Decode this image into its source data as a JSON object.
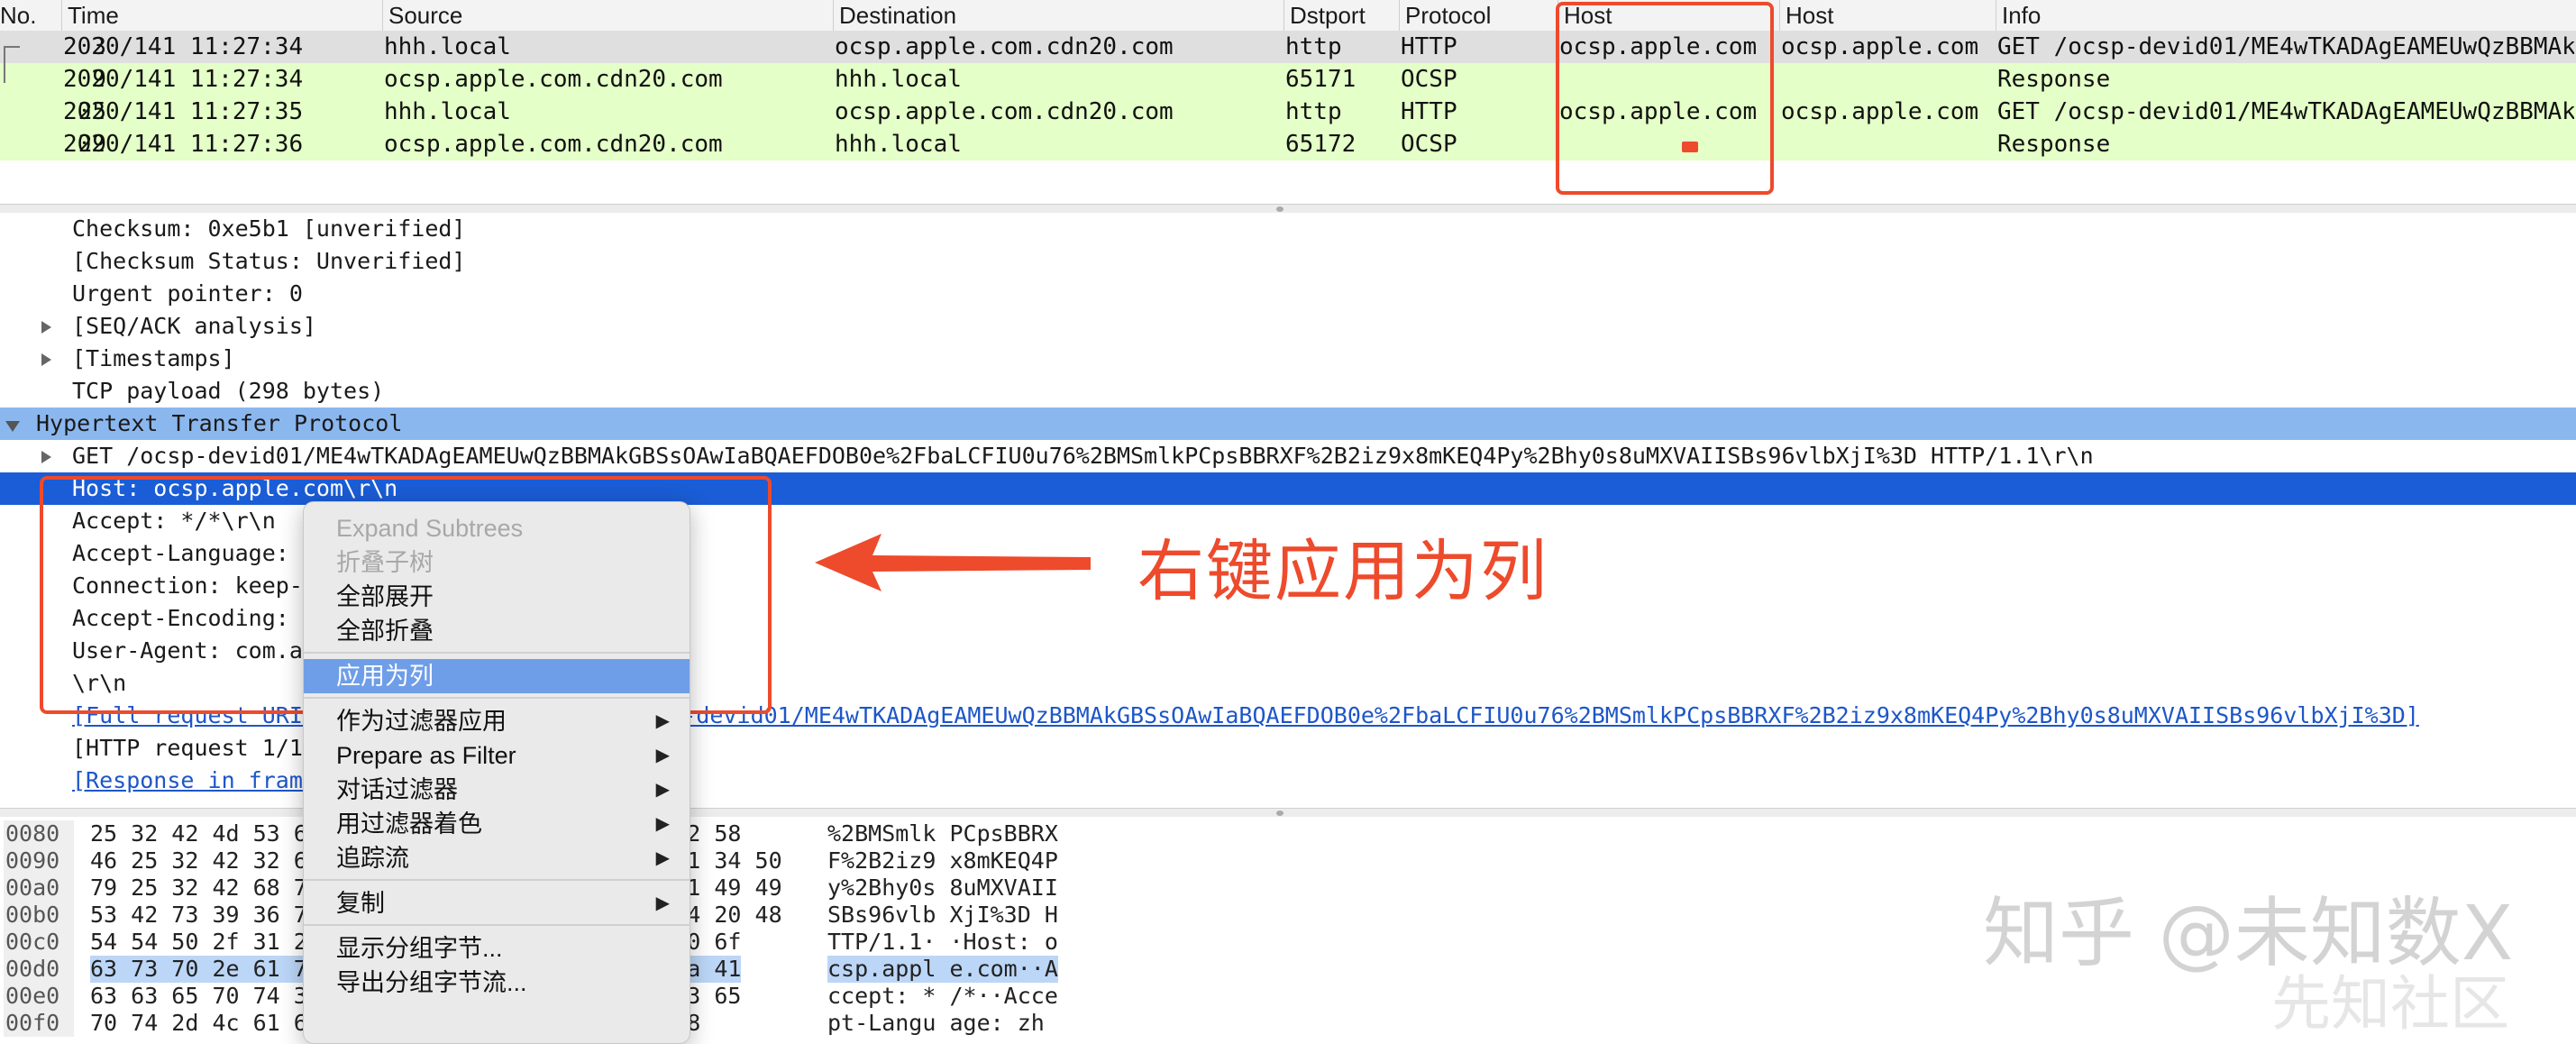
{
  "packet_list": {
    "columns": [
      "No.",
      "Time",
      "Source",
      "Destination",
      "Dstport",
      "Protocol",
      "Host",
      "Host",
      "Info"
    ],
    "rows": [
      {
        "no": "3",
        "time": "2020/141 11:27:34",
        "source": "hhh.local",
        "destination": "ocsp.apple.com.cdn20.com",
        "dstport": "http",
        "protocol": "HTTP",
        "host1": "ocsp.apple.com",
        "host2": "ocsp.apple.com",
        "info": "GET /ocsp-devid01/ME4wTKADAgEAMEUwQzBBMAkGBSsOAwIaBQAEFDOB0e%2FbaLCFIU0u76%2BMSmlkPCpsBBRXF%2B2iz9x8mKEQ4Py%2Bhy0s8uMXVAIISBs96vlbXjI%3D HTTP/1.1"
      },
      {
        "no": "9",
        "time": "2020/141 11:27:34",
        "source": "ocsp.apple.com.cdn20.com",
        "destination": "hhh.local",
        "dstport": "65171",
        "protocol": "OCSP",
        "host1": "",
        "host2": "",
        "info": "Response"
      },
      {
        "no": "25",
        "time": "2020/141 11:27:35",
        "source": "hhh.local",
        "destination": "ocsp.apple.com.cdn20.com",
        "dstport": "http",
        "protocol": "HTTP",
        "host1": "ocsp.apple.com",
        "host2": "ocsp.apple.com",
        "info": "GET /ocsp-devid01/ME4wTKADAgEAMEUwQzBBMAkGBSsOAwIaBQAEFDOB0e%2FbaLCFIU0u76%2BMSmlkPCpsBBRXF%2B2iz9x8mKEQ4Py%2Bhy0s8uMXVAIISBs96vlbXjI%3D HTTP/1.1"
      },
      {
        "no": "29",
        "time": "2020/141 11:27:36",
        "source": "ocsp.apple.com.cdn20.com",
        "destination": "hhh.local",
        "dstport": "65172",
        "protocol": "OCSP",
        "host1": "",
        "host2": "",
        "info": "Response"
      }
    ]
  },
  "details": {
    "rows": [
      {
        "text": "Checksum: 0xe5b1 [unverified]",
        "indent": 1,
        "toggle": "none",
        "style": "normal"
      },
      {
        "text": "[Checksum Status: Unverified]",
        "indent": 1,
        "toggle": "none",
        "style": "normal"
      },
      {
        "text": "Urgent pointer: 0",
        "indent": 1,
        "toggle": "none",
        "style": "normal"
      },
      {
        "text": "[SEQ/ACK analysis]",
        "indent": 1,
        "toggle": "right",
        "style": "normal"
      },
      {
        "text": "[Timestamps]",
        "indent": 1,
        "toggle": "right",
        "style": "normal"
      },
      {
        "text": "TCP payload (298 bytes)",
        "indent": 1,
        "toggle": "none",
        "style": "normal"
      },
      {
        "text": "Hypertext Transfer Protocol",
        "indent": 0,
        "toggle": "down",
        "style": "highlight"
      },
      {
        "text": "GET /ocsp-devid01/ME4wTKADAgEAMEUwQzBBMAkGBSsOAwIaBQAEFDOB0e%2FbaLCFIU0u76%2BMSmlkPCpsBBRXF%2B2iz9x8mKEQ4Py%2Bhy0s8uMXVAIISBs96vlbXjI%3D HTTP/1.1\\r\\n",
        "indent": 1,
        "toggle": "right",
        "style": "normal"
      },
      {
        "text": "Host: ocsp.apple.com\\r\\n",
        "indent": 1,
        "toggle": "none",
        "style": "selected"
      },
      {
        "text": "Accept: */*\\r\\n",
        "indent": 1,
        "toggle": "none",
        "style": "normal"
      },
      {
        "text": "Accept-Language: ",
        "indent": 1,
        "toggle": "none",
        "style": "normal"
      },
      {
        "text": "Connection: keep-",
        "indent": 1,
        "toggle": "none",
        "style": "normal"
      },
      {
        "text": "Accept-Encoding: ",
        "indent": 1,
        "toggle": "none",
        "style": "normal"
      },
      {
        "text": "User-Agent: com.a",
        "indent": 1,
        "toggle": "none",
        "style": "normal"
      },
      {
        "text": "\\r\\n",
        "indent": 1,
        "toggle": "none",
        "style": "normal"
      },
      {
        "text": "[Full request URI: http://ocsp.apple.com/ocsp-devid01/ME4wTKADAgEAMEUwQzBBMAkGBSsOAwIaBQAEFDOB0e%2FbaLCFIU0u76%2BMSmlkPCpsBBRXF%2B2iz9x8mKEQ4Py%2Bhy0s8uMXVAIISBs96vlbXjI%3D]",
        "indent": 1,
        "toggle": "none",
        "style": "link"
      },
      {
        "text": "[HTTP request 1/1]",
        "indent": 1,
        "toggle": "none",
        "style": "normal"
      },
      {
        "text": "[Response in frame: 29]",
        "indent": 1,
        "toggle": "none",
        "style": "link"
      }
    ]
  },
  "bytes": {
    "rows": [
      {
        "offset": "0080",
        "hex": "25 32 42 4d 53 6d 6c 6b  20 50 43 70 73 42 52 58",
        "ascii": "%2BMSmlk PCpsBBRX",
        "highlight": false
      },
      {
        "offset": "0090",
        "hex": "46 25 32 42 32 69 7a 39  20 78 38 6d 4b 45 51 34 50",
        "ascii": "F%2B2iz9 x8mKEQ4P",
        "highlight": false
      },
      {
        "offset": "00a0",
        "hex": "79 25 32 42 68 79 30 73  20 38 75 4d 58 56 41 49 49",
        "ascii": "y%2Bhy0s 8uMXVAII",
        "highlight": false
      },
      {
        "offset": "00b0",
        "hex": "53 42 73 39 36 76 6c 62  20 58 6a 49 25 33 44 20 48",
        "ascii": "SBs96vlb XjI%3D H",
        "highlight": false
      },
      {
        "offset": "00c0",
        "hex": "54 54 50 2f 31 2e 31 0d  0a 48 6f 73 74 3a 20 6f",
        "ascii": "TTP/1.1· ·Host: o",
        "highlight": false
      },
      {
        "offset": "00d0",
        "hex": "63 73 70 2e 61 70 70 6c  65 2e 63 6f 6d 0d 0a 41",
        "ascii": "csp.appl e.com··A",
        "highlight": true
      },
      {
        "offset": "00e0",
        "hex": "63 63 65 70 74 3a 20 2a  2f 2a 0d 0a 41 63 63 65",
        "ascii": "ccept: * /*··Acce",
        "highlight": false
      },
      {
        "offset": "00f0",
        "hex": "70 74 2d 4c 61 6e 67 75  61 67 65 3a 20 7a 68",
        "ascii": "pt-Langu age: zh",
        "highlight": false
      }
    ]
  },
  "context_menu": {
    "items": [
      {
        "label": "Expand Subtrees",
        "state": "disabled",
        "submenu": false
      },
      {
        "label": "折叠子树",
        "state": "disabled",
        "submenu": false
      },
      {
        "label": "全部展开",
        "state": "normal",
        "submenu": false
      },
      {
        "label": "全部折叠",
        "state": "normal",
        "submenu": false
      },
      {
        "label": "---"
      },
      {
        "label": "应用为列",
        "state": "highlight",
        "submenu": false
      },
      {
        "label": "---"
      },
      {
        "label": "作为过滤器应用",
        "state": "normal",
        "submenu": true
      },
      {
        "label": "Prepare as Filter",
        "state": "normal",
        "submenu": true
      },
      {
        "label": "对话过滤器",
        "state": "normal",
        "submenu": true
      },
      {
        "label": "用过滤器着色",
        "state": "normal",
        "submenu": true
      },
      {
        "label": "追踪流",
        "state": "normal",
        "submenu": true
      },
      {
        "label": "---"
      },
      {
        "label": "复制",
        "state": "normal",
        "submenu": true
      },
      {
        "label": "---"
      },
      {
        "label": "显示分组字节...",
        "state": "normal",
        "submenu": false
      },
      {
        "label": "导出分组字节流...",
        "state": "normal",
        "submenu": false
      }
    ],
    "submenu_glyph": "▶"
  },
  "annotation": {
    "text": "右键应用为列",
    "color": "#ee4a2c"
  },
  "watermark": {
    "text": "知乎 @未知数X",
    "text2": "先知社区"
  },
  "colors": {
    "row_green": "#e4ffc7",
    "row_selected_gray": "#dfdfdf",
    "detail_highlight": "#8bb7ef",
    "detail_selected": "#1a5dd6",
    "menu_highlight": "#6f9ee8",
    "link": "#1d56c8"
  }
}
